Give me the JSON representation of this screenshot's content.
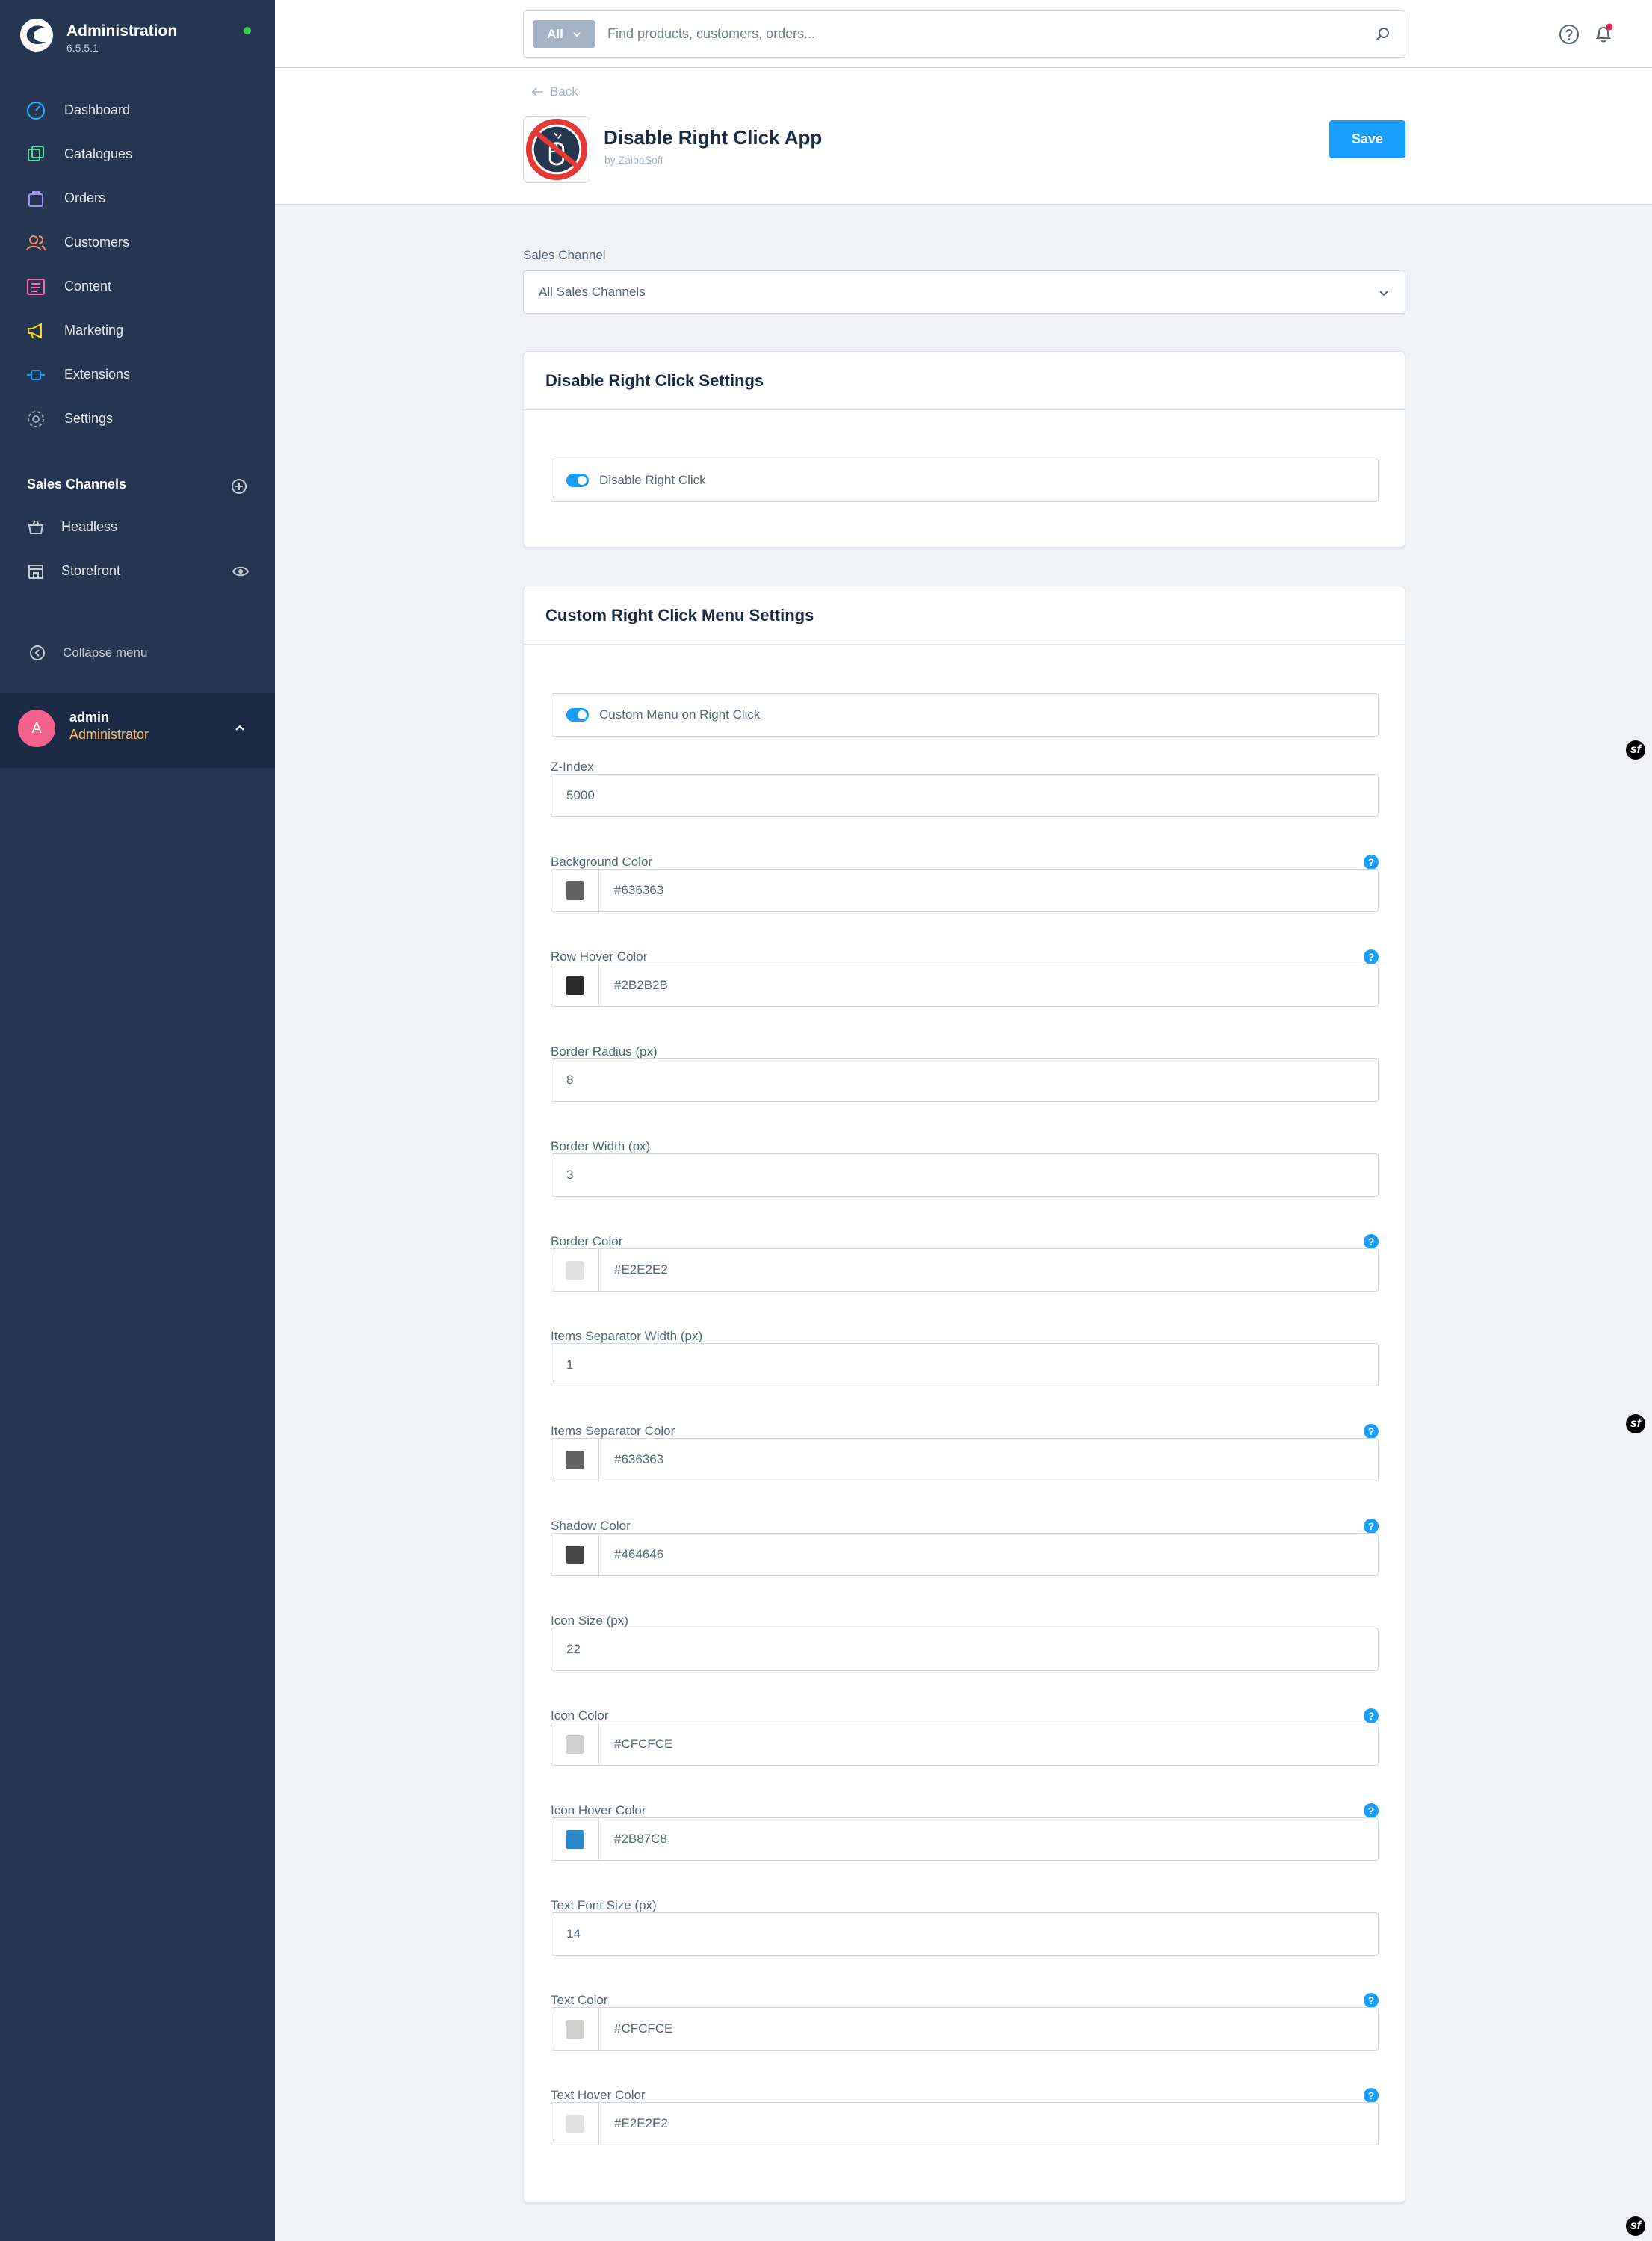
{
  "app": {
    "title": "Administration",
    "version": "6.5.5.1"
  },
  "nav": [
    {
      "label": "Dashboard",
      "icon": "dashboard-icon",
      "color": "#1fb6ff"
    },
    {
      "label": "Catalogues",
      "icon": "catalogues-icon",
      "color": "#57d9a3"
    },
    {
      "label": "Orders",
      "icon": "orders-icon",
      "color": "#a092f0"
    },
    {
      "label": "Customers",
      "icon": "customers-icon",
      "color": "#f88962"
    },
    {
      "label": "Content",
      "icon": "content-icon",
      "color": "#ff68b4"
    },
    {
      "label": "Marketing",
      "icon": "marketing-icon",
      "color": "#ffd700"
    },
    {
      "label": "Extensions",
      "icon": "extensions-icon",
      "color": "#189eff"
    },
    {
      "label": "Settings",
      "icon": "settings-icon",
      "color": "#9aa8b5"
    }
  ],
  "sales_channels": {
    "title": "Sales Channels",
    "items": [
      {
        "label": "Headless"
      },
      {
        "label": "Storefront"
      }
    ]
  },
  "collapse_label": "Collapse menu",
  "user": {
    "initial": "A",
    "name": "admin",
    "role": "Administrator"
  },
  "search": {
    "type_label": "All",
    "placeholder": "Find products, customers, orders..."
  },
  "header": {
    "back_label": "Back",
    "app_name": "Disable Right Click App",
    "app_by": "by ZaibaSoft",
    "save_label": "Save"
  },
  "sales_channel_field": {
    "label": "Sales Channel",
    "value": "All Sales Channels"
  },
  "card1": {
    "title": "Disable Right Click Settings",
    "switch_label": "Disable Right Click"
  },
  "card2": {
    "title": "Custom Right Click Menu Settings",
    "switch_label": "Custom Menu on Right Click",
    "fields": [
      {
        "label": "Z-Index",
        "value": "5000"
      },
      {
        "label": "Background Color",
        "value": "#636363",
        "color": "#636363"
      },
      {
        "label": "Row Hover Color",
        "value": "#2B2B2B",
        "color": "#2B2B2B"
      },
      {
        "label": "Border Radius (px)",
        "value": "8"
      },
      {
        "label": "Border Width (px)",
        "value": "3"
      },
      {
        "label": "Border Color",
        "value": "#E2E2E2",
        "color": "#E2E2E2"
      },
      {
        "label": "Items Separator Width (px)",
        "value": "1"
      },
      {
        "label": "Items Separator Color",
        "value": "#636363",
        "color": "#636363"
      },
      {
        "label": "Shadow Color",
        "value": "#464646",
        "color": "#464646"
      },
      {
        "label": "Icon Size (px)",
        "value": "22"
      },
      {
        "label": "Icon Color",
        "value": "#CFCFCE",
        "color": "#CFCFCE"
      },
      {
        "label": "Icon Hover Color",
        "value": "#2B87C8",
        "color": "#2B87C8"
      },
      {
        "label": "Text Font Size (px)",
        "value": "14"
      },
      {
        "label": "Text Color",
        "value": "#CFCFCE",
        "color": "#CFCFCE"
      },
      {
        "label": "Text Hover Color",
        "value": "#E2E2E2",
        "color": "#E2E2E2"
      }
    ]
  },
  "help_glyph": "?",
  "debug_badge": "sf"
}
